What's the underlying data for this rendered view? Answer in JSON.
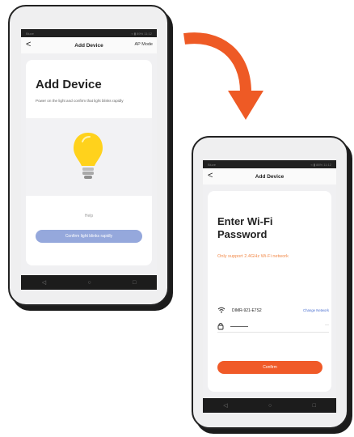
{
  "phone1": {
    "status_left": "Bluve",
    "status_right": "≈ ▮ 89% 11:12",
    "header": {
      "back": "<",
      "title": "Add Device",
      "right": "AP Mode"
    },
    "heading": "Add Device",
    "description": "Power on the light and confirm that light blinks rapidly",
    "help": "Help",
    "confirm": "Confirm light blinks rapidly",
    "nav": [
      "◁",
      "○",
      "□"
    ]
  },
  "phone2": {
    "status_left": "Bluve",
    "status_right": "≈ ▮ 88% 11:12",
    "header": {
      "back": "<",
      "title": "Add Device"
    },
    "heading_line1": "Enter Wi-Fi",
    "heading_line2": "Password",
    "warning": "Only support 2.4GHz Wi-Fi network",
    "ssid": "DIMR-921-E7S2",
    "change_network": "Change Network",
    "eye": "—",
    "confirm": "Confirm",
    "nav": [
      "◁",
      "○",
      "□"
    ]
  },
  "icons": {
    "wifi": "wifi-icon",
    "lock": "lock-icon",
    "bulb": "bulb-icon",
    "arrow": "curved-arrow"
  },
  "colors": {
    "accent_orange": "#f05a28",
    "confirm_blue": "#95a8dc",
    "arrow": "#ee5a25"
  }
}
